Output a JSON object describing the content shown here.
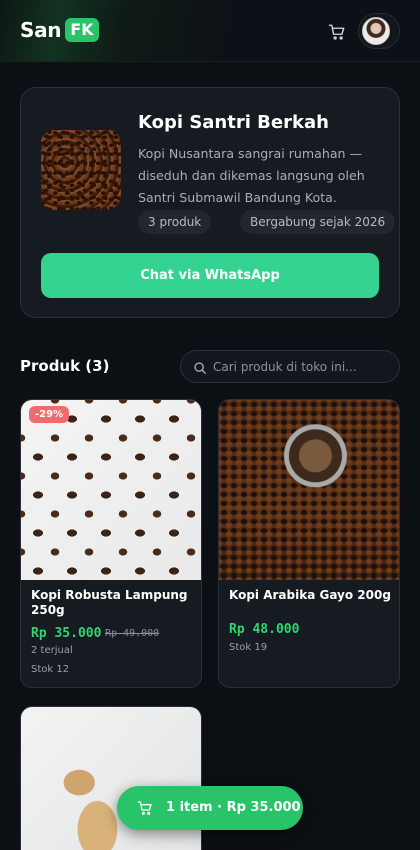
{
  "header": {
    "logo_text": "San",
    "logo_badge": "FK",
    "cart_icon": "cart-icon",
    "avatar_icon": "avatar"
  },
  "store": {
    "name": "Kopi Santri Berkah",
    "description": "Kopi Nusantara sangrai rumahan — diseduh dan dikemas langsung oleh Santri Submawil Bandung Kota.",
    "product_count": "3 produk",
    "joined": "Bergabung sejak 2026",
    "whatsapp_label": "Chat via WhatsApp"
  },
  "products_section": {
    "title": "Produk (3)",
    "search_placeholder": "Cari produk di toko ini..."
  },
  "products": [
    {
      "discount": "-29%",
      "name": "Kopi Robusta Lampung 250g",
      "price": "Rp 35.000",
      "old_price": "Rp 49.000",
      "sold": "2 terjual",
      "stock": "Stok 12"
    },
    {
      "name": "Kopi Arabika Gayo 200g",
      "price": "Rp 48.000",
      "stock": "Stok 19"
    },
    {
      "name": ""
    }
  ],
  "cart_bar": {
    "label": "1 item · Rp 35.000"
  },
  "colors": {
    "accent_green": "#29c46a",
    "whatsapp_green": "#34d391",
    "price_green": "#2ed573",
    "discount_red": "#f06b6b",
    "background": "#0c0f14"
  }
}
